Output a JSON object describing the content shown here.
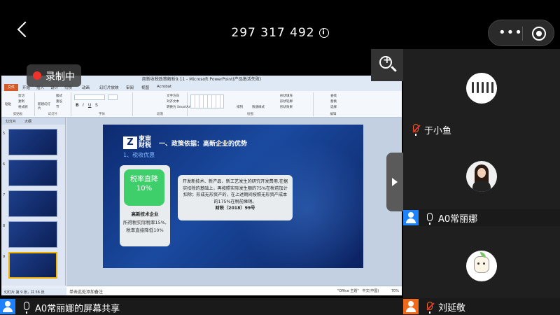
{
  "topbar": {
    "meeting_id": "297 317 492",
    "info_icon": "i"
  },
  "recording": {
    "label": "录制中"
  },
  "ppt": {
    "window_title": "商新收税政策解析9.11 - Microsoft PowerPoint(产品激活失败)",
    "tabs": [
      "文件",
      "开始",
      "插入",
      "设计",
      "切换",
      "动画",
      "幻灯片放映",
      "审阅",
      "视图",
      "Acrobat"
    ],
    "ribbon": {
      "clipboard": {
        "label": "剪贴板",
        "paste": "粘贴",
        "cut": "剪切",
        "copy": "复制",
        "format_painter": "格式刷"
      },
      "slides": {
        "label": "幻灯片",
        "new_slide": "新建幻灯片",
        "layout": "版式",
        "reset": "重设",
        "section": "节"
      },
      "font": {
        "label": "字体"
      },
      "paragraph": {
        "label": "段落",
        "text_direction": "文字方向",
        "align_text": "对齐文本",
        "smartart": "转换为 SmartArt"
      },
      "drawing": {
        "label": "绘图",
        "arrange": "排列",
        "quick_styles": "快速样式",
        "shape_fill": "形状填充",
        "shape_outline": "形状轮廓",
        "shape_effects": "形状效果"
      },
      "editing": {
        "label": "编辑",
        "find": "查找",
        "replace": "替换",
        "select": "选择"
      }
    },
    "panel_tabs": [
      "幻灯片",
      "大纲"
    ],
    "thumbnails": [
      "5",
      "6",
      "7",
      "8",
      "9"
    ],
    "slide": {
      "logo_text": "柬审财税",
      "heading": "一、政策依据：高新企业的优势",
      "subheading": "1、税收优惠",
      "badge_line1": "税率直降",
      "badge_line2": "10%",
      "card_title": "高新技术企业",
      "card_line1": "所得税实际税率15%,",
      "card_line2": "税率直接降低10%",
      "right_text": "开发新技术、新产品、新工艺发生的研究开发费用,在据实扣除的基础上，再按照实际发生额的75%在税前加计扣除；形成无形资产的，在上述期间按照无形资产成本的175%在税前摊销。",
      "right_source": "财税（2018）99号"
    },
    "notes_placeholder": "单击此处添加备注",
    "status_left": "幻灯片 第 9 张，共 56 张",
    "status_theme": "\"Office 主题\"",
    "status_lang": "中文(中国)",
    "status_zoom": "70%"
  },
  "share_bar": {
    "presenter": "A0常丽娜的屏幕共享"
  },
  "participants": [
    {
      "name": "于小鱼",
      "avatar": "group-photo-avatar",
      "mic": "muted"
    },
    {
      "name": "A0常丽娜",
      "avatar": "woman-photo-avatar",
      "mic": "on"
    },
    {
      "name": "刘延敬",
      "avatar": "cartoon-cat-avatar",
      "mic": "muted"
    }
  ],
  "colors": {
    "record_red": "#f0322a",
    "badge_green": "#3fcf6a",
    "slide_blue": "#0d2a70",
    "user_blue": "#1e82ff",
    "mute_orange": "#f06a1a"
  }
}
